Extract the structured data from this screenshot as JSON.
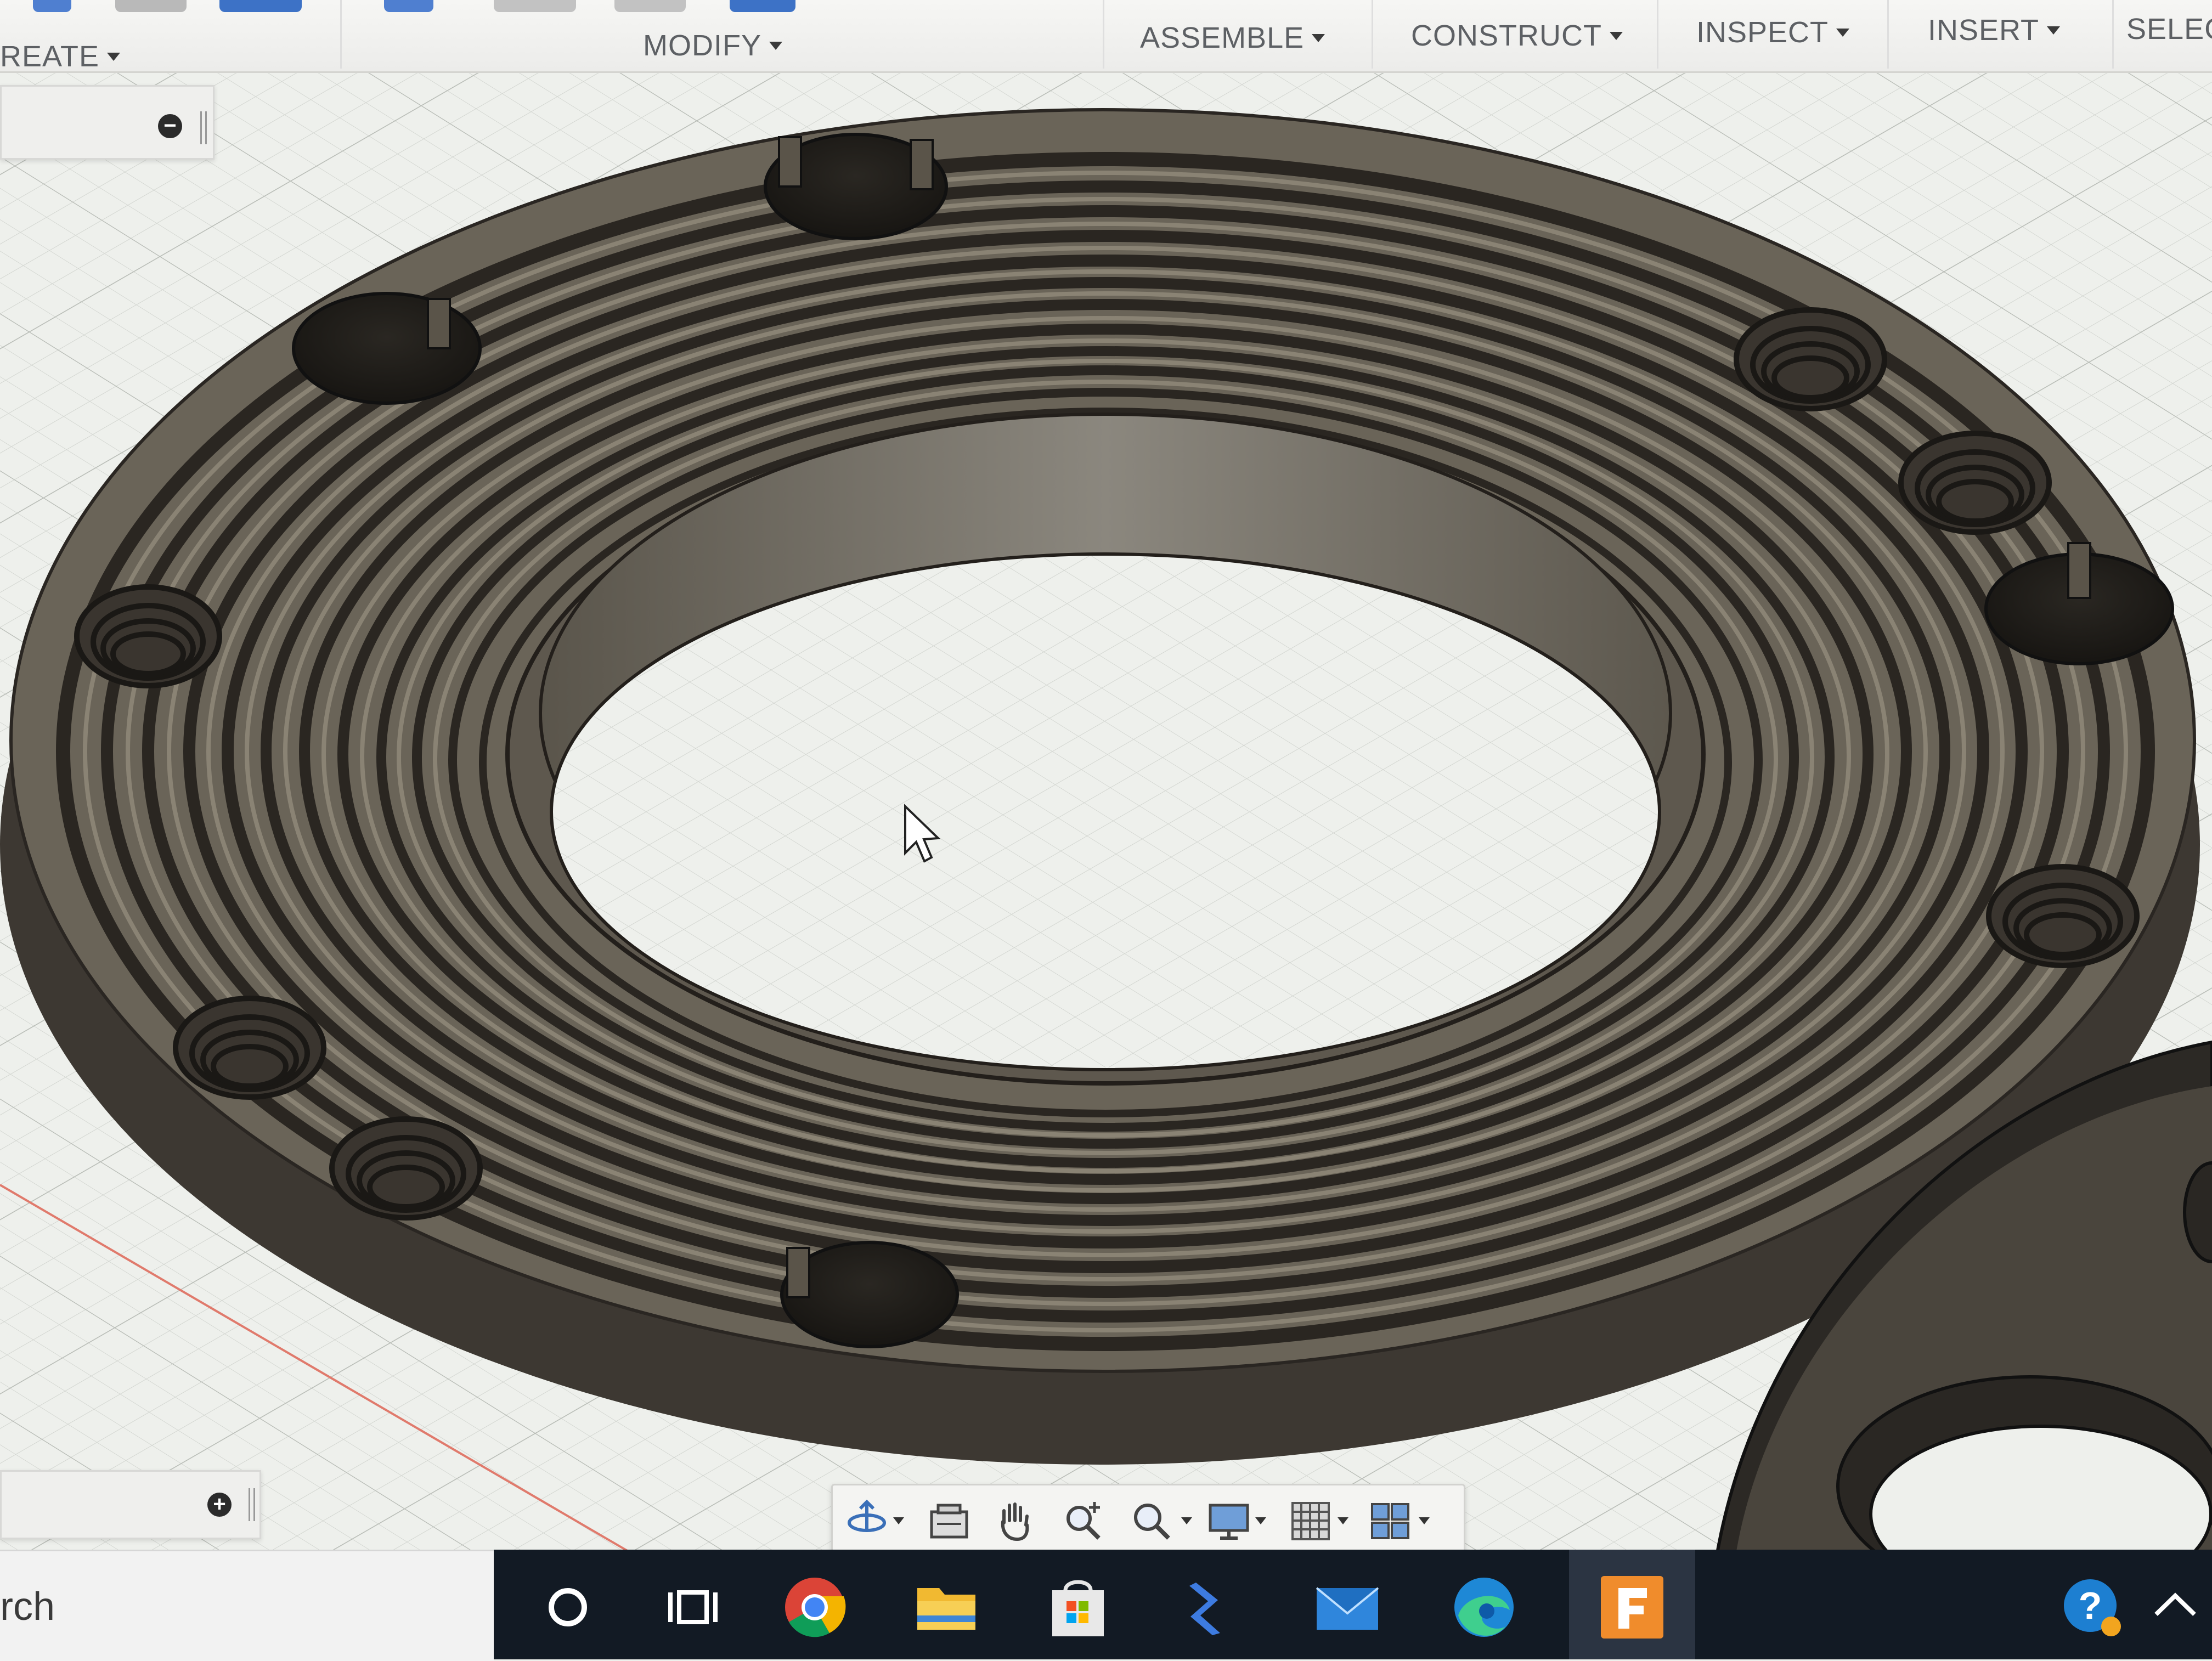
{
  "toolbar": {
    "tabs": {
      "create": "REATE",
      "modify": "MODIFY",
      "assemble": "ASSEMBLE",
      "construct": "CONSTRUCT",
      "inspect": "INSPECT",
      "insert": "INSERT",
      "select": "SELEC"
    }
  },
  "panels": {
    "browser_collapse_icon": "minus-circle-icon",
    "comments_expand_icon": "plus-circle-icon"
  },
  "navigation_bar": {
    "tools": [
      "orbit-icon",
      "look-at-icon",
      "pan-hand-icon",
      "zoom-icon",
      "zoom-window-icon",
      "display-settings-icon",
      "grid-settings-icon",
      "viewports-icon"
    ]
  },
  "taskbar": {
    "search_text": "rch",
    "apps": [
      "cortana-icon",
      "task-view-icon",
      "chrome-icon",
      "file-explorer-icon",
      "microsoft-store-icon",
      "visual-studio-icon",
      "mail-icon",
      "edge-icon",
      "fusion-360-icon"
    ],
    "tray": [
      "help-icon",
      "show-hidden-icons-chevron"
    ]
  },
  "colors": {
    "model_body": "#4c463d",
    "model_rim_light": "#6d665a",
    "grid_background": "#eef0ec",
    "taskbar": "#121a24",
    "fusion_accent": "#e8862a"
  }
}
